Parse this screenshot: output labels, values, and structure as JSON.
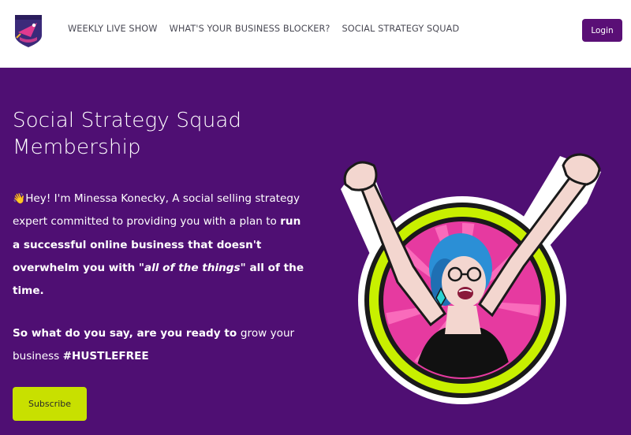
{
  "header": {
    "logo_icon": "rocket-shield-logo",
    "nav": [
      {
        "label": "WEEKLY LIVE SHOW"
      },
      {
        "label": "WHAT'S YOUR BUSINESS BLOCKER?"
      },
      {
        "label": "SOCIAL STRATEGY SQUAD"
      }
    ],
    "login_label": "Login"
  },
  "hero": {
    "title_line1": "Social Strategy Squad",
    "title_line2": "Membership",
    "intro_emoji": "👋",
    "intro_1": "Hey! I'm Minessa Konecky, A social selling strategy expert committed to providing you with a plan to ",
    "intro_bold_1": "run a successful online business that doesn't overwhelm you with ",
    "intro_italic": "\"all of the things\"",
    "intro_bold_2": " all of the time.",
    "question_bold": "So what do you say, are you ready to ",
    "question_plain": "grow your business ",
    "question_tag": "#HUSTLEFREE",
    "subscribe_label": "Subscribe"
  },
  "colors": {
    "brand_purple": "#4f0f73",
    "button_purple": "#5a0f76",
    "accent_lime": "#c8e000",
    "accent_pink": "#e02b8a"
  }
}
